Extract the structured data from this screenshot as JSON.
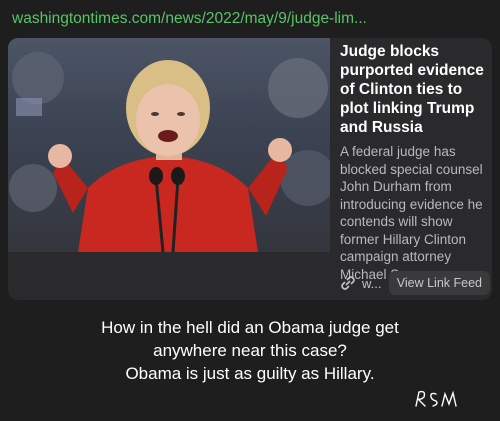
{
  "url_bar": {
    "text": "washingtontimes.com/news/2022/may/9/judge-lim..."
  },
  "card": {
    "image_icon": "photo-of-speaker-at-podium",
    "headline": "Judge blocks purported evidence of Clinton ties to plot linking Trump and Russia",
    "snippet": "A federal judge has blocked special counsel John Durham from introducing evidence he contends will show former Hillary Clinton campaign attorney Michael Sussmann...",
    "source_icon": "link-icon",
    "source_short": "w...",
    "view_button_label": "View Link Feed"
  },
  "caption": {
    "line1": "How in the hell did an Obama judge get",
    "line2": "anywhere near this case?",
    "line3": "Obama is just as guilty as Hillary."
  },
  "signature": {
    "text": "RSM"
  },
  "colors": {
    "background": "#1e1e1e",
    "card": "#2a2a2c",
    "url_green": "#57c46a",
    "snippet_gray": "#b9b9be"
  }
}
